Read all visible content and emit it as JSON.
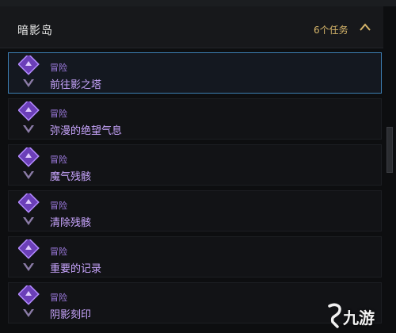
{
  "header": {
    "title": "暗影岛",
    "count": "6个任务"
  },
  "quests": [
    {
      "category": "冒险",
      "name": "前往影之塔",
      "selected": true
    },
    {
      "category": "冒险",
      "name": "弥漫的绝望气息",
      "selected": false
    },
    {
      "category": "冒险",
      "name": "魔气残骸",
      "selected": false
    },
    {
      "category": "冒险",
      "name": "清除残骸",
      "selected": false
    },
    {
      "category": "冒险",
      "name": "重要的记录",
      "selected": false
    },
    {
      "category": "冒险",
      "name": "阴影刻印",
      "selected": false
    }
  ],
  "watermark": {
    "text": "九游"
  },
  "colors": {
    "accent_gold": "#d6b56a",
    "quest_purple": "#c9a6ff",
    "selected_border": "#3d7fb3"
  },
  "icons": {
    "quest_type": "purple-diamond-quest-icon",
    "quest_rank": "chevron-rank-icon",
    "collapse": "chevron-up-icon"
  }
}
